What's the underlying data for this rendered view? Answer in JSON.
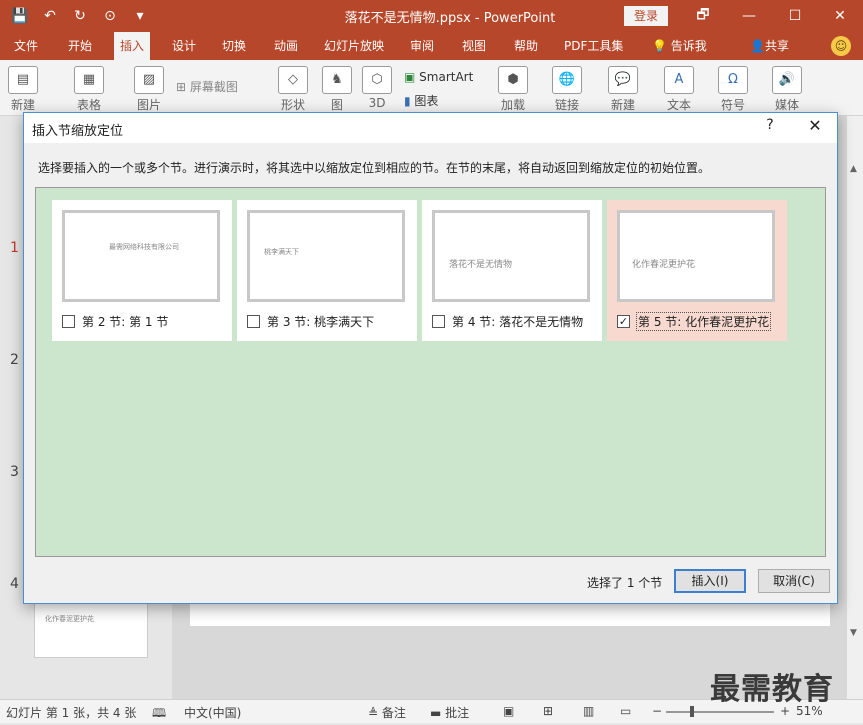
{
  "titlebar": {
    "doc_title": "落花不是无情物.ppsx  -  PowerPoint",
    "login": "登录",
    "qat": [
      "💾",
      "↶",
      "↻",
      "⊙",
      "▾"
    ],
    "win": [
      "🗗",
      "—",
      "☐",
      "✕"
    ]
  },
  "tabs": [
    {
      "label": "文件"
    },
    {
      "label": "开始"
    },
    {
      "label": "插入"
    },
    {
      "label": "设计"
    },
    {
      "label": "切换"
    },
    {
      "label": "动画"
    },
    {
      "label": "幻灯片放映"
    },
    {
      "label": "审阅"
    },
    {
      "label": "视图"
    },
    {
      "label": "帮助"
    },
    {
      "label": "PDF工具集"
    },
    {
      "label": "告诉我"
    },
    {
      "label": "共享"
    }
  ],
  "ribbon": {
    "new_slide": "新建",
    "table": "表格",
    "picture": "图片",
    "screenshot": "屏幕截图",
    "shapes": "形状",
    "icons": "图",
    "models": "3D",
    "smartart": "SmartArt",
    "chart": "图表",
    "addins": "加载",
    "link": "链接",
    "comment": "新建",
    "text": "文本",
    "symbol": "符号",
    "media": "媒体"
  },
  "leftpane": {
    "numbers": [
      "1",
      "2",
      "3",
      "4"
    ],
    "thumb4_text": "化作春泥更护花"
  },
  "dialog": {
    "title": "插入节缩放定位",
    "help": "?",
    "close": "✕",
    "instruction": "选择要插入的一个或多个节。进行演示时，将其选中以缩放定位到相应的节。在节的末尾，将自动返回到缩放定位的初始位置。",
    "sections": [
      {
        "label": "第 2 节: 第 1 节",
        "thumb_text": "最需网络科技有限公司",
        "checked": false
      },
      {
        "label": "第 3 节: 桃李满天下",
        "thumb_text": "桃李满天下",
        "checked": false
      },
      {
        "label": "第 4 节: 落花不是无情物",
        "thumb_text": "落花不是无情物",
        "checked": false
      },
      {
        "label": "第 5 节: 化作春泥更护花",
        "thumb_text": "化作春泥更护花",
        "checked": true
      }
    ],
    "selection_count": "选择了 1 个节",
    "insert_button": "插入(I)",
    "cancel_button": "取消(C)"
  },
  "statusbar": {
    "slide_info": "幻灯片 第 1 张，共 4 张",
    "language": "中文(中国)",
    "notes": "备注",
    "comments": "批注",
    "zoom": "51%"
  },
  "watermark": "最需教育"
}
